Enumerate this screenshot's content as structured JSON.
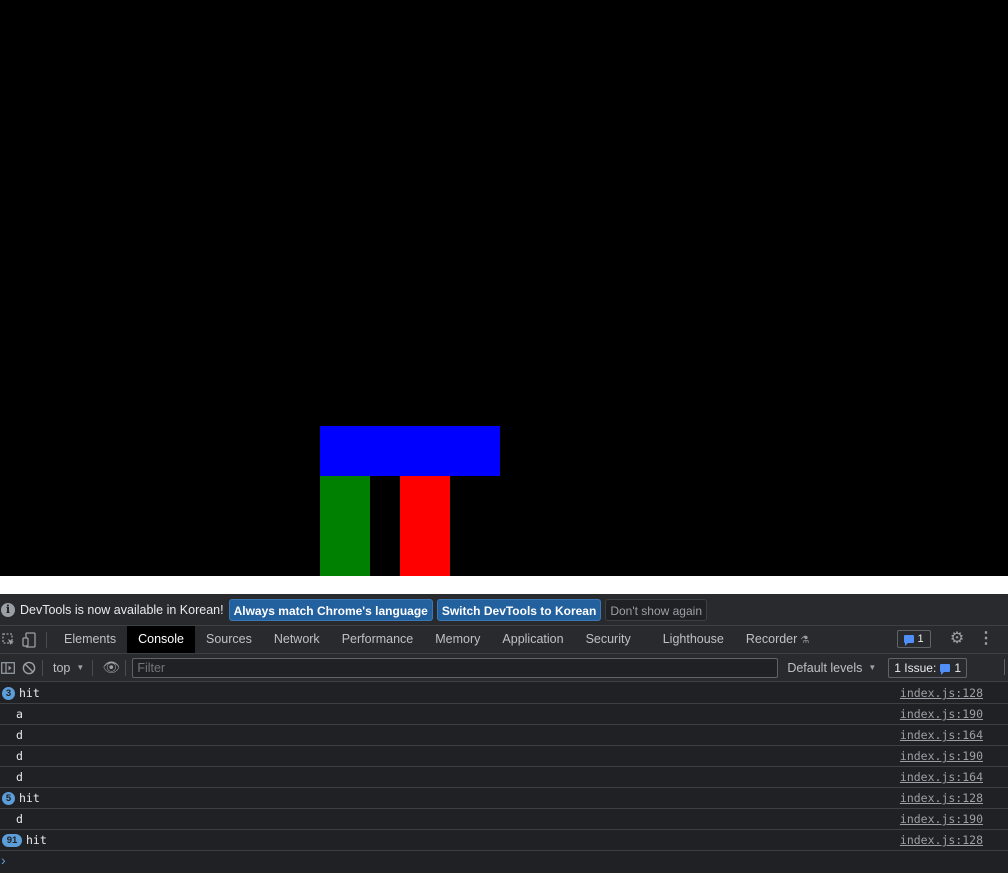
{
  "game": {
    "background": "#000000",
    "blocks": [
      {
        "name": "blue-block",
        "color": "#0000ff"
      },
      {
        "name": "green-block",
        "color": "#008000"
      },
      {
        "name": "red-block",
        "color": "#ff0000"
      }
    ]
  },
  "infobar": {
    "message": "DevTools is now available in Korean!",
    "btn_match": "Always match Chrome's language",
    "btn_switch": "Switch DevTools to Korean",
    "btn_dismiss": "Don't show again"
  },
  "tabs": {
    "items": [
      "Elements",
      "Console",
      "Sources",
      "Network",
      "Performance",
      "Memory",
      "Application",
      "Security",
      "Lighthouse",
      "Recorder"
    ],
    "active": "Console",
    "issue_count": "1"
  },
  "console_toolbar": {
    "context": "top",
    "filter_placeholder": "Filter",
    "levels": "Default levels",
    "issues_label": "1 Issue:",
    "issues_count": "1"
  },
  "logs": [
    {
      "count": "3",
      "text": "hit",
      "source": "index.js:128"
    },
    {
      "count": "",
      "text": "a",
      "source": "index.js:190"
    },
    {
      "count": "",
      "text": "d",
      "source": "index.js:164"
    },
    {
      "count": "",
      "text": "d",
      "source": "index.js:190"
    },
    {
      "count": "",
      "text": "d",
      "source": "index.js:164"
    },
    {
      "count": "5",
      "text": "hit",
      "source": "index.js:128"
    },
    {
      "count": "",
      "text": "d",
      "source": "index.js:190"
    },
    {
      "count": "91",
      "text": "hit",
      "source": "index.js:128"
    }
  ],
  "prompt_symbol": "›"
}
